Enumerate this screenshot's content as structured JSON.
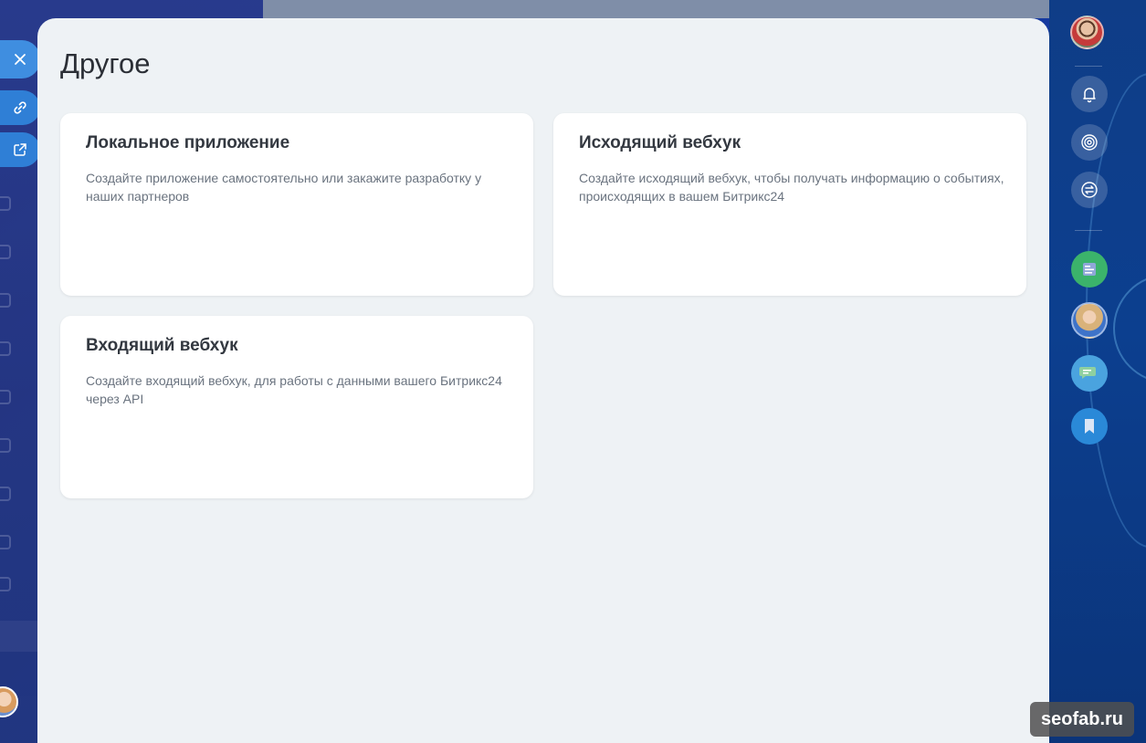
{
  "page": {
    "title": "Другое"
  },
  "cards": [
    {
      "title": "Локальное приложение",
      "description": "Создайте приложение самостоятельно или закажите разработку у наших партнеров"
    },
    {
      "title": "Исходящий вебхук",
      "description": "Создайте исходящий вебхук, чтобы получать информацию о событиях, происходящих в вашем Битрикс24"
    },
    {
      "title": "Входящий вебхук",
      "description": "Создайте входящий вебхук, для работы с данными вашего Битрикс24 через API"
    }
  ],
  "slider_buttons": {
    "close_icon": "close-icon",
    "copy_link_icon": "link-icon",
    "open_new_window_icon": "external-link-icon"
  },
  "right_rail": {
    "icons": [
      "bell-icon",
      "spiral-icon",
      "exchange-icon",
      "bookmark-icon"
    ],
    "colors": {
      "green_app": "#3bb36b",
      "chat_app": "#4aa3df",
      "bookmark": "#2a89d8"
    }
  },
  "watermark": {
    "text": "seofab.ru"
  },
  "colors": {
    "panel_bg": "#eef2f5",
    "card_bg": "#ffffff",
    "title_text": "#2b2f36",
    "desc_text": "#6a737f",
    "slider_button": "#3a8ee6"
  }
}
